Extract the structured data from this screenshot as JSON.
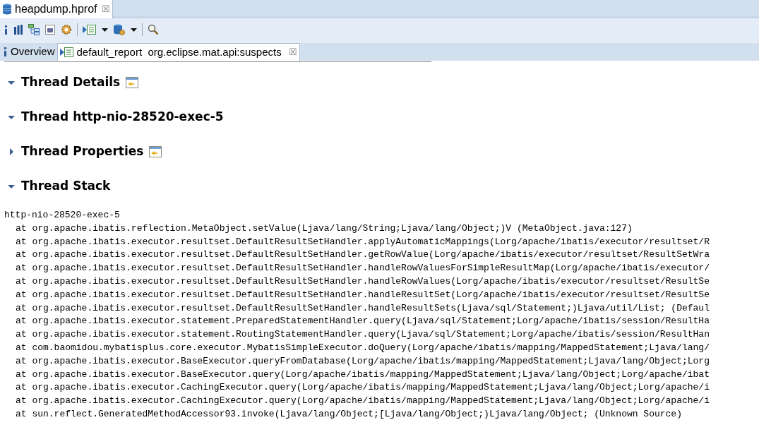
{
  "editor_tab": {
    "title": "heapdump.hprof",
    "close": "☒"
  },
  "report_tabs": [
    {
      "kind": "info",
      "label": "Overview",
      "selected": false
    },
    {
      "kind": "report",
      "label": "default_report  org.eclipse.mat.api:suspects",
      "selected": true,
      "close": "☒"
    }
  ],
  "sections": [
    {
      "title": "Thread Details",
      "expanded": true,
      "details_icon": true
    },
    {
      "title": "Thread http-nio-28520-exec-5",
      "expanded": true,
      "details_icon": false
    },
    {
      "title": "Thread Properties",
      "expanded": false,
      "details_icon": true
    },
    {
      "title": "Thread Stack",
      "expanded": true,
      "details_icon": false
    }
  ],
  "stack": {
    "thread": "http-nio-28520-exec-5",
    "frames": [
      "at org.apache.ibatis.reflection.MetaObject.setValue(Ljava/lang/String;Ljava/lang/Object;)V (MetaObject.java:127)",
      "at org.apache.ibatis.executor.resultset.DefaultResultSetHandler.applyAutomaticMappings(Lorg/apache/ibatis/executor/resultset/R",
      "at org.apache.ibatis.executor.resultset.DefaultResultSetHandler.getRowValue(Lorg/apache/ibatis/executor/resultset/ResultSetWra",
      "at org.apache.ibatis.executor.resultset.DefaultResultSetHandler.handleRowValuesForSimpleResultMap(Lorg/apache/ibatis/executor/",
      "at org.apache.ibatis.executor.resultset.DefaultResultSetHandler.handleRowValues(Lorg/apache/ibatis/executor/resultset/ResultSe",
      "at org.apache.ibatis.executor.resultset.DefaultResultSetHandler.handleResultSet(Lorg/apache/ibatis/executor/resultset/ResultSe",
      "at org.apache.ibatis.executor.resultset.DefaultResultSetHandler.handleResultSets(Ljava/sql/Statement;)Ljava/util/List; (Defaul",
      "at org.apache.ibatis.executor.statement.PreparedStatementHandler.query(Ljava/sql/Statement;Lorg/apache/ibatis/session/ResultHa",
      "at org.apache.ibatis.executor.statement.RoutingStatementHandler.query(Ljava/sql/Statement;Lorg/apache/ibatis/session/ResultHan",
      "at com.baomidou.mybatisplus.core.executor.MybatisSimpleExecutor.doQuery(Lorg/apache/ibatis/mapping/MappedStatement;Ljava/lang/",
      "at org.apache.ibatis.executor.BaseExecutor.queryFromDatabase(Lorg/apache/ibatis/mapping/MappedStatement;Ljava/lang/Object;Lorg",
      "at org.apache.ibatis.executor.BaseExecutor.query(Lorg/apache/ibatis/mapping/MappedStatement;Ljava/lang/Object;Lorg/apache/ibat",
      "at org.apache.ibatis.executor.CachingExecutor.query(Lorg/apache/ibatis/mapping/MappedStatement;Ljava/lang/Object;Lorg/apache/i",
      "at org.apache.ibatis.executor.CachingExecutor.query(Lorg/apache/ibatis/mapping/MappedStatement;Ljava/lang/Object;Lorg/apache/i",
      "at sun.reflect.GeneratedMethodAccessor93.invoke(Ljava/lang/Object;[Ljava/lang/Object;)Ljava/lang/Object; (Unknown Source)"
    ]
  }
}
